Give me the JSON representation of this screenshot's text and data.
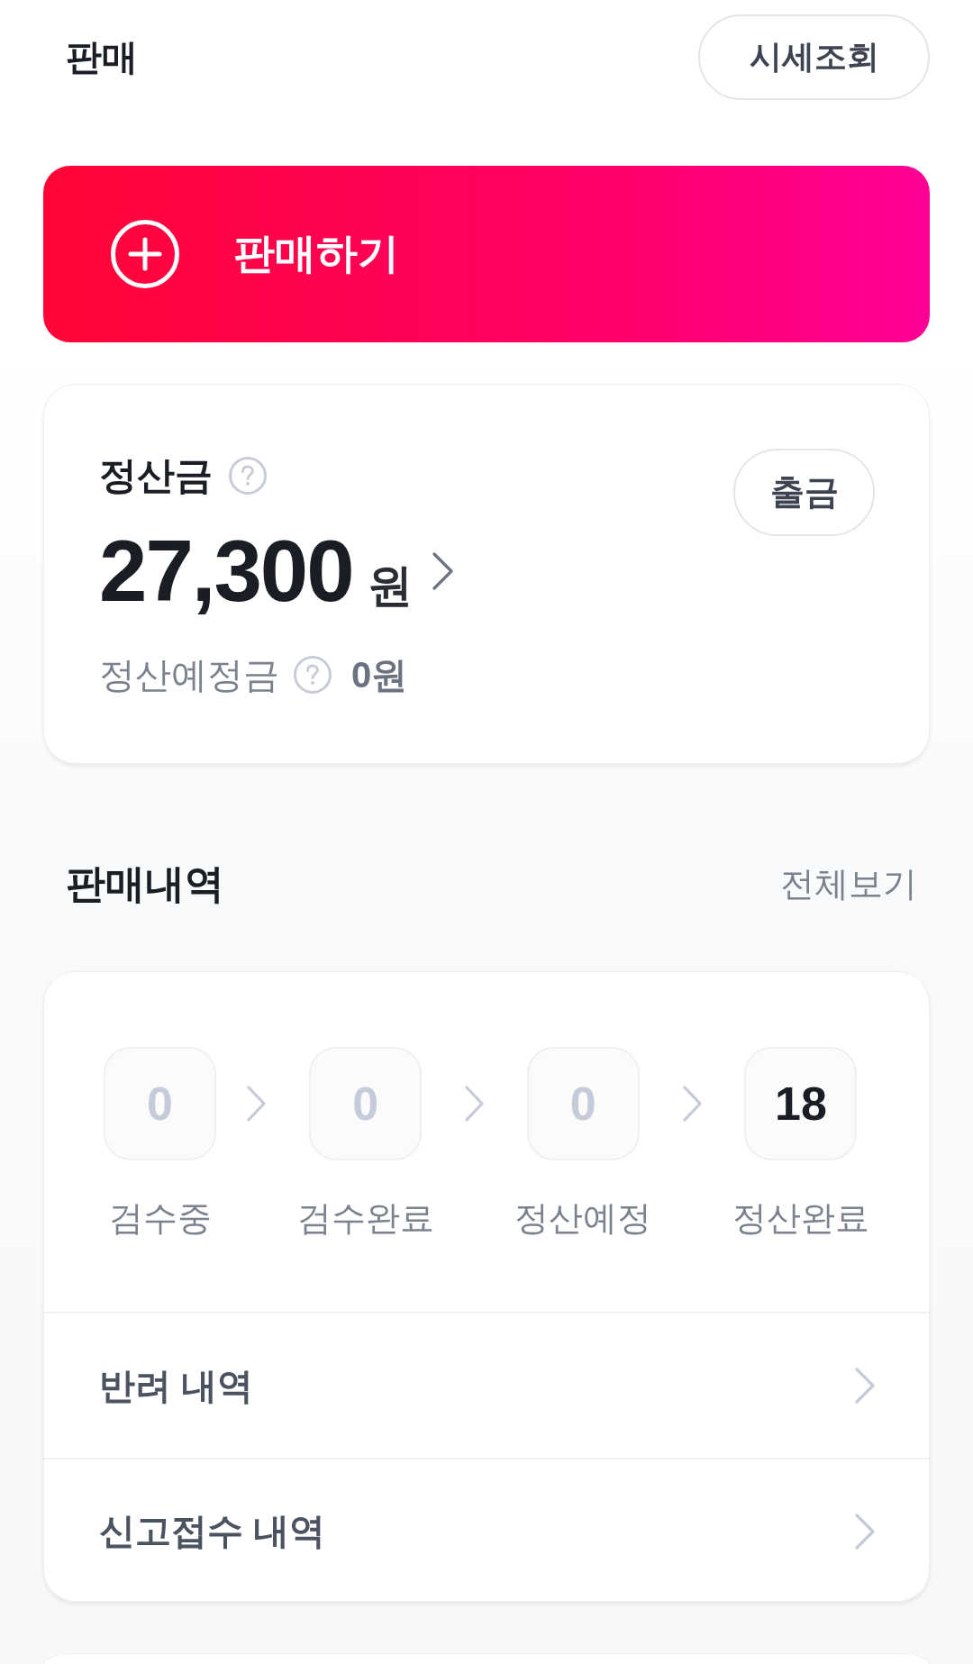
{
  "header": {
    "title": "판매",
    "price_button": "시세조회"
  },
  "sell_button": {
    "label": "판매하기"
  },
  "settlement": {
    "title": "정산금",
    "amount": "27,300",
    "unit": "원",
    "withdraw_button": "출금",
    "pending_label": "정산예정금",
    "pending_amount": "0원"
  },
  "sales_history": {
    "title": "판매내역",
    "view_all": "전체보기",
    "steps": [
      {
        "count": "0",
        "label": "검수중",
        "active": false
      },
      {
        "count": "0",
        "label": "검수완료",
        "active": false
      },
      {
        "count": "0",
        "label": "정산예정",
        "active": false
      },
      {
        "count": "18",
        "label": "정산완료",
        "active": true
      }
    ],
    "links": [
      {
        "label": "반려 내역"
      },
      {
        "label": "신고접수 내역"
      }
    ]
  }
}
